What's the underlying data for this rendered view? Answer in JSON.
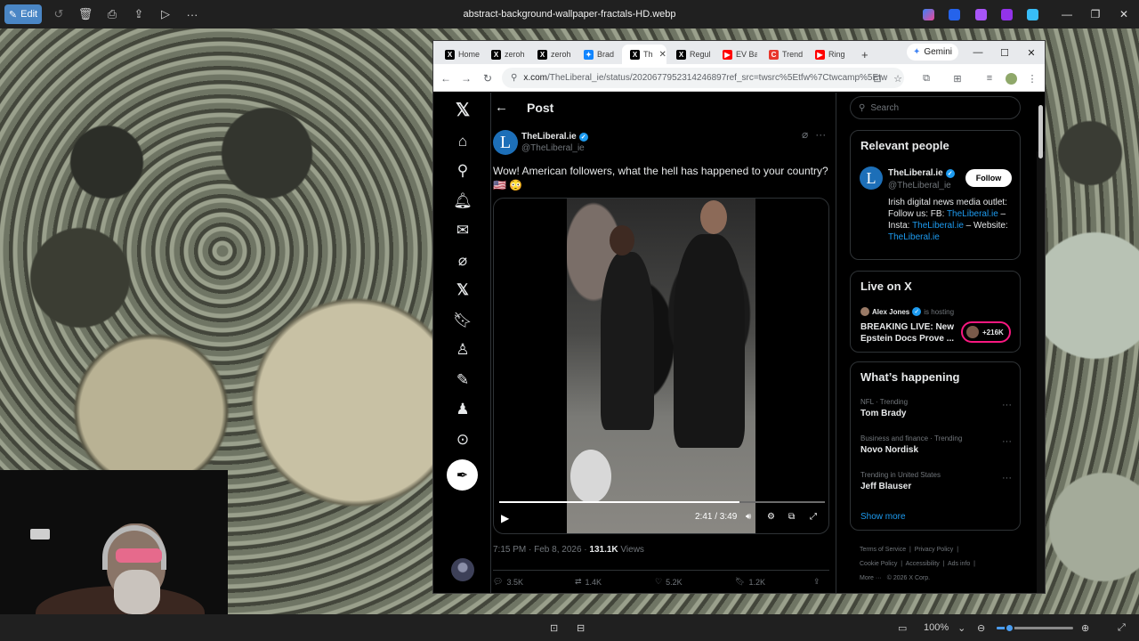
{
  "photos_app": {
    "edit_label": "Edit",
    "file_title": "abstract-background-wallpaper-fractals-HD.webp",
    "zoom": "100%",
    "zoom_level_fraction": 0.16
  },
  "browser": {
    "tabs": [
      {
        "label": "Home",
        "icon": "x-logo-icon",
        "color": "#000000"
      },
      {
        "label": "zeroh",
        "icon": "x-logo-icon",
        "color": "#000000"
      },
      {
        "label": "zeroh",
        "icon": "x-logo-icon",
        "color": "#000000"
      },
      {
        "label": "Brad",
        "icon": "butterfly-icon",
        "color": "#1185fe"
      },
      {
        "label": "Th",
        "icon": "x-logo-icon",
        "color": "#000000",
        "active": true
      },
      {
        "label": "Regul",
        "icon": "x-logo-icon",
        "color": "#000000"
      },
      {
        "label": "EV Ba",
        "icon": "youtube-icon",
        "color": "#ff0000"
      },
      {
        "label": "Trend",
        "icon": "trend-icon",
        "color": "#e8372c"
      },
      {
        "label": "Ring",
        "icon": "youtube-icon",
        "color": "#ff0000"
      }
    ],
    "gemini_label": "Gemini",
    "url_domain": "x.com",
    "url_rest": "/TheLiberal_ie/status/2020677952314246897ref_src=twsrc%5Etfw%7Ctwcamp%5Etw"
  },
  "x": {
    "page_title": "Post",
    "post": {
      "author_name": "TheLiberal.ie",
      "author_handle": "@TheLiberal_ie",
      "avatar_letter": "L",
      "text": "Wow! American followers, what the hell has happened to your country?",
      "emoji": "🇺🇸 😳",
      "video_time": "2:41 / 3:49",
      "video_progress_fraction": 0.737,
      "timestamp": "7:15 PM · Feb 8, 2026 · ",
      "views_count": "131.1K",
      "views_label": " Views",
      "replies": "3.5K",
      "reposts": "1.4K",
      "likes": "5.2K",
      "bookmarks": "1.2K"
    },
    "search_placeholder": "Search",
    "relevant": {
      "title": "Relevant people",
      "name": "TheLiberal.ie",
      "handle": "@TheLiberal_ie",
      "follow_label": "Follow",
      "bio_1": "Irish digital news media outlet: Follow us: FB: ",
      "bio_link_1": "TheLiberal.ie",
      "bio_2": " – Insta: ",
      "bio_link_2": "TheLiberal.ie",
      "bio_3": " – Website: ",
      "bio_link_3": "TheLiberal.ie"
    },
    "live": {
      "title": "Live on X",
      "host": "Alex Jones",
      "hosting_label": "is hosting",
      "stream_title": "BREAKING LIVE: New Epstein Docs Prove ...",
      "listeners": "+216K"
    },
    "happening": {
      "title": "What’s happening",
      "trends": [
        {
          "category": "NFL · Trending",
          "name": "Tom Brady"
        },
        {
          "category": "Business and finance · Trending",
          "name": "Novo Nordisk"
        },
        {
          "category": "Trending in United States",
          "name": "Jeff Blauser"
        }
      ],
      "show_more": "Show more"
    },
    "footer": {
      "terms": "Terms of Service",
      "privacy": "Privacy Policy",
      "cookie": "Cookie Policy",
      "accessibility": "Accessibility",
      "ads": "Ads info",
      "more": "More ···",
      "copyright": "© 2026 X Corp."
    }
  },
  "colors": {
    "accent": "#1d9bf0",
    "edit_button": "#4a86c5"
  }
}
